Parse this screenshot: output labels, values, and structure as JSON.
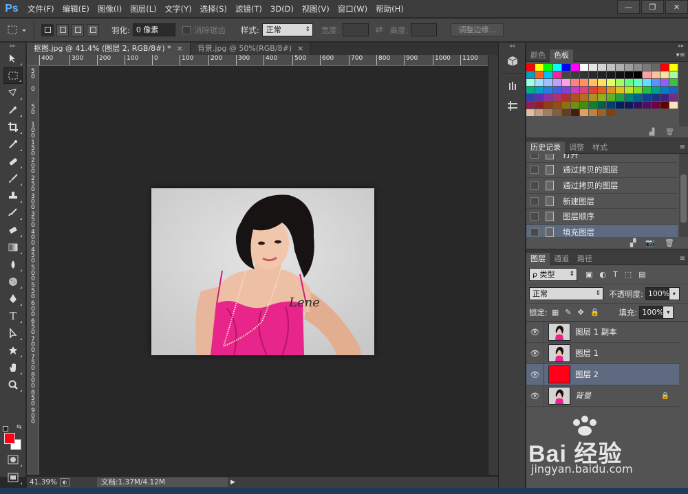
{
  "app": {
    "logo": "Ps"
  },
  "menu": [
    "文件(F)",
    "编辑(E)",
    "图像(I)",
    "图层(L)",
    "文字(Y)",
    "选择(S)",
    "滤镜(T)",
    "3D(D)",
    "视图(V)",
    "窗口(W)",
    "帮助(H)"
  ],
  "window_controls": {
    "minimize": "—",
    "restore": "❐",
    "close": "✕"
  },
  "options": {
    "feather_label": "羽化:",
    "feather_value": "0 像素",
    "antialias_label": "消除锯齿",
    "style_label": "样式:",
    "style_value": "正常",
    "width_label": "宽度:",
    "height_label": "高度:",
    "refine_edge": "调整边缘..."
  },
  "tabs": [
    {
      "label": "抠图.jpg @ 41.4% (图层 2, RGB/8#) *",
      "close": "×"
    },
    {
      "label": "背景.jpg @ 50%(RGB/8#)",
      "close": "×"
    }
  ],
  "ruler_h": [
    "400",
    "300",
    "200",
    "100",
    "0",
    "100",
    "200",
    "300",
    "400",
    "500",
    "600",
    "700",
    "800",
    "900",
    "1000",
    "1100"
  ],
  "ruler_v": [
    "5\n0",
    "0",
    "5\n0",
    "1\n0\n0",
    "1\n5\n0",
    "2\n0\n0",
    "2\n5\n0",
    "3\n0\n0",
    "3\n5\n0",
    "4\n0\n0",
    "4\n5\n0",
    "5\n0\n0",
    "5\n5\n0",
    "6\n0\n0",
    "6\n5\n0",
    "7\n0\n0",
    "7\n5\n0",
    "8\n0\n0",
    "8\n5\n0",
    "9\n0\n0"
  ],
  "document": {
    "signature": "Lene"
  },
  "status": {
    "zoom": "41.39%",
    "doc_size": "文档:1.37M/4.12M",
    "arrow": "▶"
  },
  "color_panel": {
    "tabs": [
      "颜色",
      "色板"
    ],
    "active_tab": 1,
    "colors": {
      "foreground": "#ff0018",
      "background": "#ffffff"
    }
  },
  "swatches": [
    "#ff0000",
    "#ffff00",
    "#00ff00",
    "#00ffff",
    "#0000ff",
    "#ff00ff",
    "#ffffff",
    "#e6e6e6",
    "#d4d4d4",
    "#c2c2c2",
    "#b0b0b0",
    "#9e9e9e",
    "#8c8c8c",
    "#7a7a7a",
    "#686868",
    "#ff0000",
    "#ffff00",
    "#00a0c0",
    "#ff6020",
    "#00c0ff",
    "#ff20a0",
    "#454545",
    "#3c3c3c",
    "#333333",
    "#2a2a2a",
    "#222222",
    "#1a1a1a",
    "#111111",
    "#090909",
    "#000000",
    "#ffa0a0",
    "#ffc0a0",
    "#ffe0a0",
    "#a0ffa0",
    "#a0ffe0",
    "#a0e0ff",
    "#a0c0ff",
    "#c0a0ff",
    "#ffa0e0",
    "#ff8080",
    "#ff9060",
    "#ffc060",
    "#ffe060",
    "#e0ff60",
    "#a0ff60",
    "#60ff80",
    "#60ffc0",
    "#60e0ff",
    "#6090ff",
    "#9060ff",
    "#40c040",
    "#00b080",
    "#00a0c0",
    "#2080e0",
    "#4060e0",
    "#8040e0",
    "#c040c0",
    "#e04080",
    "#e04040",
    "#e06020",
    "#e09020",
    "#e0c020",
    "#c0e020",
    "#80e020",
    "#20c040",
    "#00a090",
    "#0080c0",
    "#2060c0",
    "#3040b0",
    "#6030b0",
    "#9030a0",
    "#b03070",
    "#b03030",
    "#b05020",
    "#b07020",
    "#b09020",
    "#90b020",
    "#60b020",
    "#20a040",
    "#008070",
    "#006090",
    "#104090",
    "#203080",
    "#402080",
    "#703080",
    "#902050",
    "#902020",
    "#904010",
    "#905010",
    "#907010",
    "#709010",
    "#409010",
    "#108030",
    "#006050",
    "#004070",
    "#002060",
    "#101860",
    "#301060",
    "#501060",
    "#700040",
    "#600000",
    "#ffe0c0",
    "#e0c0a0",
    "#c0a080",
    "#a08060",
    "#806040",
    "#604020",
    "#402010",
    "#e0a060",
    "#c08040",
    "#a06020",
    "#804010"
  ],
  "swatch_footer": {
    "new": "▟",
    "trash": "🗑"
  },
  "history_panel": {
    "tabs": [
      "历史记录",
      "调整",
      "样式"
    ],
    "items": [
      "打开",
      "通过拷贝的图层",
      "通过拷贝的图层",
      "新建图层",
      "图层顺序",
      "填充图层"
    ],
    "selected": 5,
    "footer": {
      "new_doc": "▞",
      "snapshot": "📷",
      "trash": "🗑"
    }
  },
  "layers_panel": {
    "tabs": [
      "图层",
      "通道",
      "路径"
    ],
    "filter_type": "ρ 类型",
    "blend_mode": "正常",
    "opacity_label": "不透明度:",
    "opacity": "100%",
    "lock_label": "锁定:",
    "fill_label": "填充:",
    "fill": "100%",
    "layers": [
      {
        "name": "图层 1 副本",
        "thumb": "photo",
        "italic": false,
        "locked": false
      },
      {
        "name": "图层 1",
        "thumb": "photo",
        "italic": false,
        "locked": false
      },
      {
        "name": "图层 2",
        "thumb": "#ff0018",
        "italic": false,
        "locked": false,
        "selected": true
      },
      {
        "name": "背景",
        "thumb": "photo",
        "italic": true,
        "locked": true
      }
    ]
  },
  "watermark": {
    "brand": "Bai 经验",
    "url": "jingyan.baidu.com"
  }
}
